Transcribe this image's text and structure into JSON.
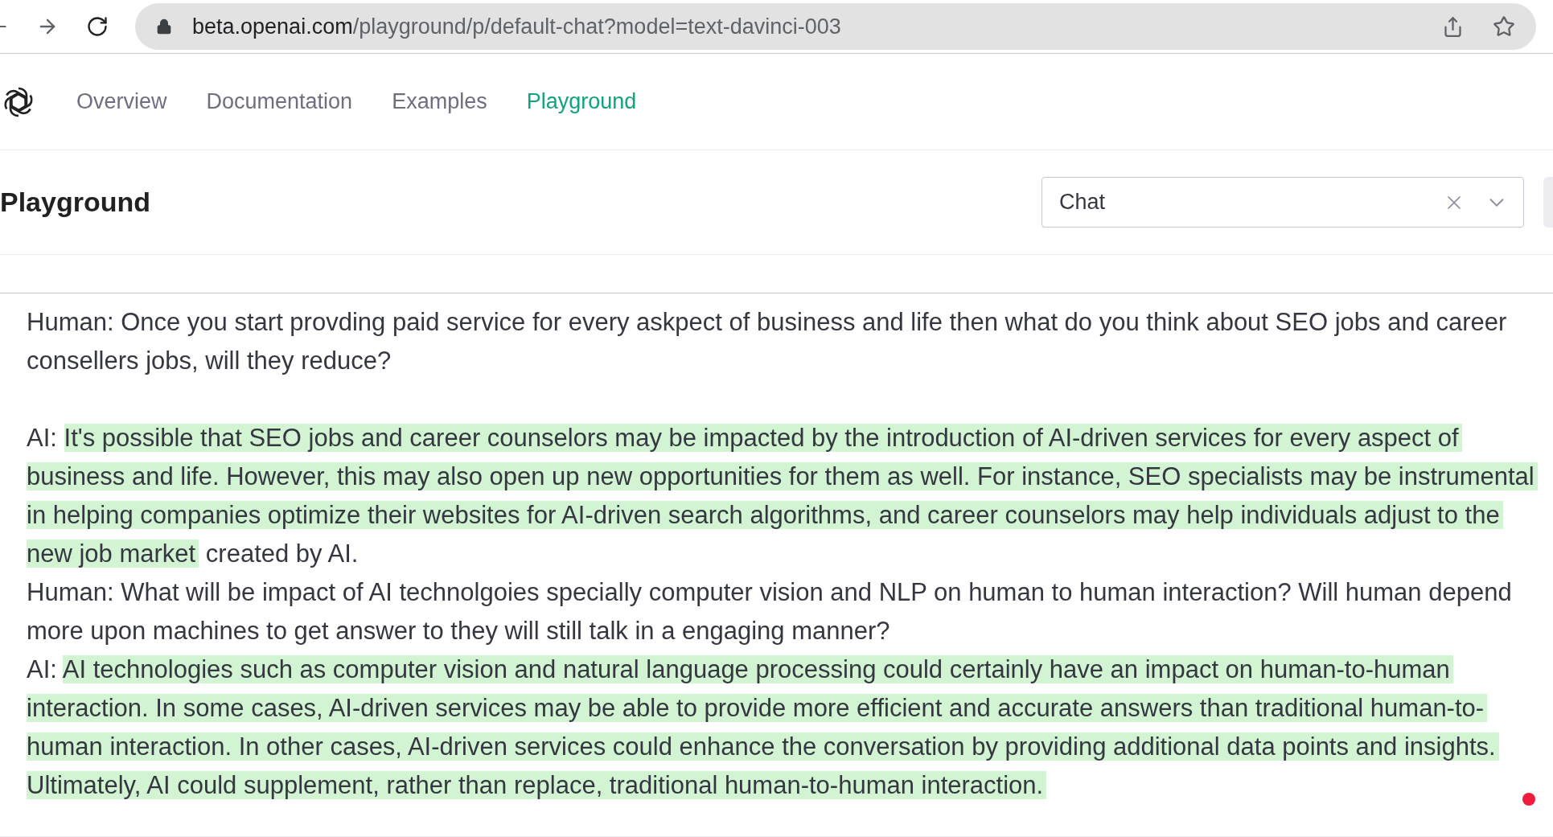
{
  "browser": {
    "url_host": "beta.openai.com",
    "url_path": "/playground/p/default-chat?model=text-davinci-003"
  },
  "nav": {
    "links": [
      {
        "label": "Overview",
        "selected": false
      },
      {
        "label": "Documentation",
        "selected": false
      },
      {
        "label": "Examples",
        "selected": false
      },
      {
        "label": "Playground",
        "selected": true
      }
    ]
  },
  "header": {
    "title": "Playground",
    "preset_select": {
      "value": "Chat"
    }
  },
  "editor": {
    "paragraphs": [
      {
        "segments": [
          {
            "text": "Human: Once you start provding paid service for every askpect of business and life then what do you think about SEO jobs and career consellers jobs, will they reduce?",
            "highlighted": false
          }
        ]
      },
      {
        "kind": "blank"
      },
      {
        "segments": [
          {
            "text": "AI: ",
            "highlighted": false
          },
          {
            "text": "It's possible that SEO jobs and career counselors may be impacted by the introduction of AI-driven services for every aspect of business and life. However, this may also open up new opportunities for them as well. For instance, SEO specialists may be instrumental in helping companies optimize their websites for AI-driven search algorithms, and career counselors may help individuals adjust to the new job market",
            "highlighted": true
          },
          {
            "text": " created by AI.",
            "highlighted": false
          }
        ]
      },
      {
        "segments": [
          {
            "text": "Human: What will be impact of AI technolgoies specially computer vision and NLP on human to human interaction? Will human  depend more upon machines to get answer to they will still talk in a engaging manner?",
            "highlighted": false
          }
        ]
      },
      {
        "segments": [
          {
            "text": "AI: ",
            "highlighted": false
          },
          {
            "text": "AI technologies such as computer vision and natural language processing could certainly have an impact on human-to-human interaction. In some cases, AI-driven services may be able to provide more efficient and accurate answers than traditional human-to-human interaction. In other cases, AI-driven services could enhance the conversation by providing additional data points and insights. Ultimately, AI could supplement, rather than replace, traditional human-to-human interaction.",
            "highlighted": true
          }
        ]
      }
    ]
  }
}
